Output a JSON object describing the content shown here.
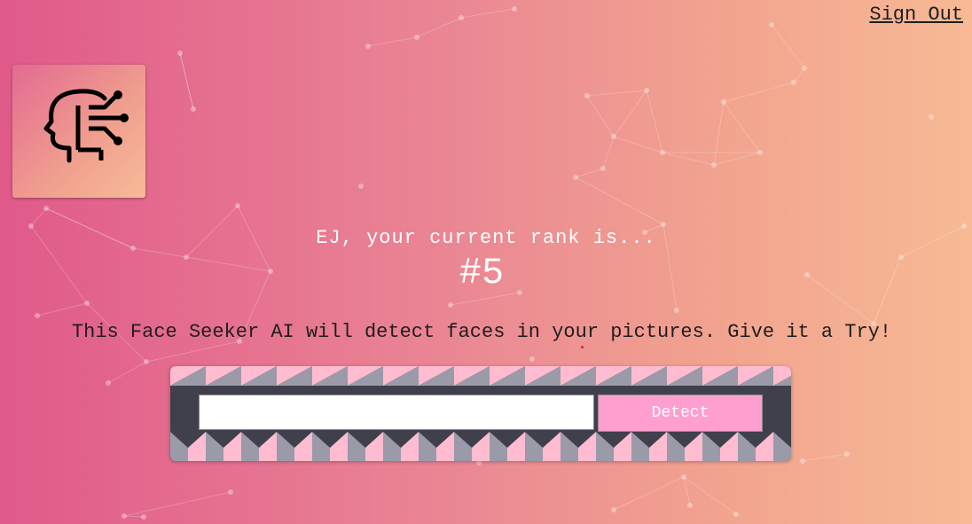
{
  "header": {
    "sign_out_label": "Sign Out"
  },
  "logo": {
    "icon": "ai-head-circuit-icon"
  },
  "rank": {
    "line": "EJ, your current rank is...",
    "value": "#5"
  },
  "tagline": "This Face Seeker AI will detect faces in your pictures. Give it a Try!",
  "form": {
    "url_value": "",
    "detect_label": "Detect"
  },
  "colors": {
    "bg_left": "#e05a8a",
    "bg_right": "#f7ba95",
    "panel_dark": "#3f404c",
    "panel_gray": "#9a9aa8",
    "panel_pink": "#ffbcd0",
    "button": "#ff9fd0"
  }
}
